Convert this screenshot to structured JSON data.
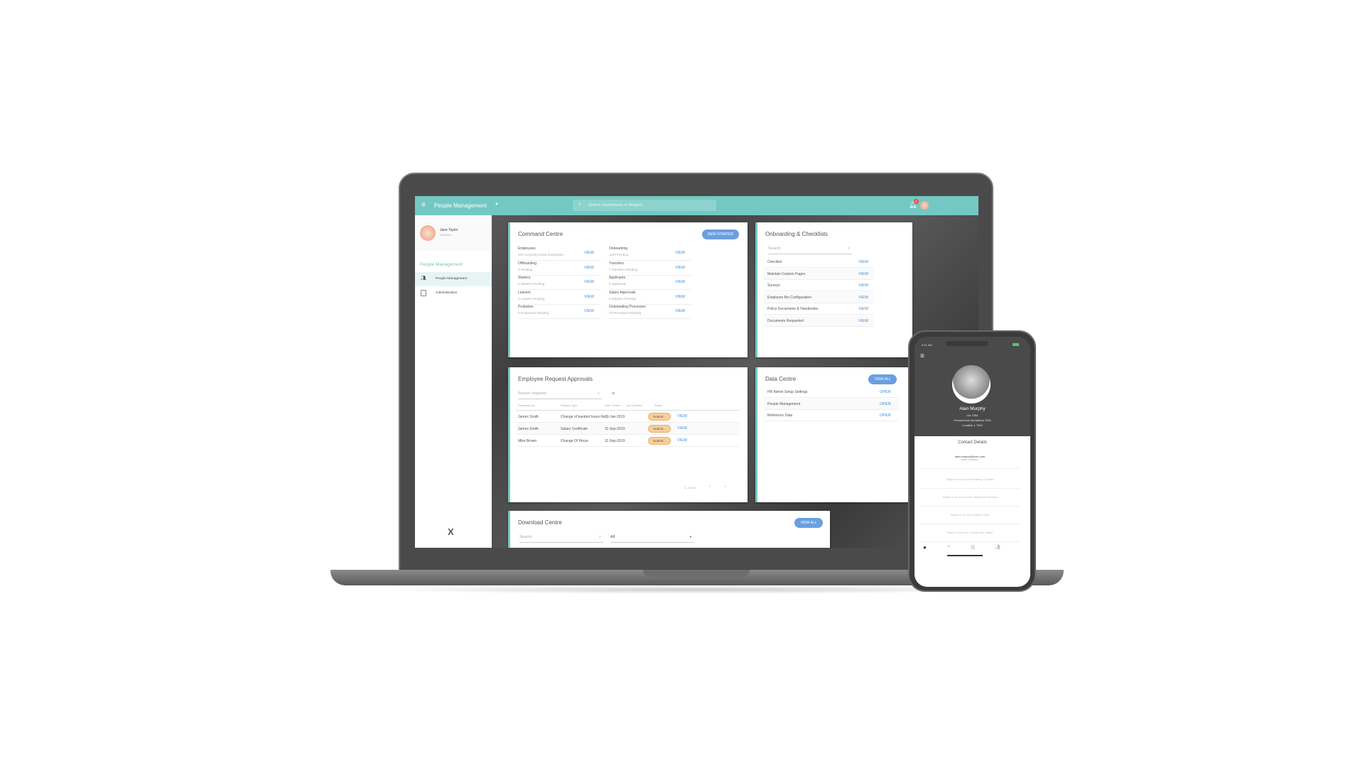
{
  "topbar": {
    "title": "People Management",
    "search_placeholder": "Search Dashboards or Widgets",
    "notification_count": "6"
  },
  "sidebar": {
    "user_name": "Jane Taylor",
    "user_id": "0000005",
    "section_title": "People Management",
    "items": [
      {
        "label": "People Management"
      },
      {
        "label": "Administration"
      }
    ],
    "logo_text": "CORE X"
  },
  "command_centre": {
    "title": "Command Centre",
    "button": "NEW STARTER",
    "view": "VIEW",
    "left": [
      {
        "label": "Employees",
        "sub": "270 Currently Active Employees"
      },
      {
        "label": "Offboarding",
        "sub": "3 Pending"
      },
      {
        "label": "Starters",
        "sub": "0 Starters Pending"
      },
      {
        "label": "Leavers",
        "sub": "0 Leavers Pending"
      },
      {
        "label": "Probation",
        "sub": "0 Probations Pending"
      }
    ],
    "right": [
      {
        "label": "Onboarding",
        "sub": "1103 Pending"
      },
      {
        "label": "Transfers",
        "sub": "7 Transfers Pending"
      },
      {
        "label": "Applicants",
        "sub": "2 Applicants"
      },
      {
        "label": "Salary Approvals",
        "sub": "6 Salaries Pending"
      },
      {
        "label": "Outstanding Processes",
        "sub": "73 Processes Pending"
      }
    ]
  },
  "onboarding": {
    "title": "Onboarding & Checklists",
    "search_placeholder": "Search",
    "view": "VIEW",
    "items": [
      "Checklist",
      "Maintain Custom Pages",
      "Surveys",
      "Employee Bio Configuration",
      "Policy Documents & Handbooks",
      "Documents Requested"
    ]
  },
  "approvals": {
    "title": "Employee Request Approvals",
    "search_placeholder": "Search requests",
    "columns": [
      "Requested By",
      "Request Type",
      "Date Created",
      "Last Updated",
      "Status"
    ],
    "view": "VIEW",
    "rows": [
      {
        "by": "James Smith",
        "type": "Change of banded hours Re...",
        "created": "30-Jan-2019",
        "updated": "",
        "status": "Submit..."
      },
      {
        "by": "James Smith",
        "type": "Salary Certificate",
        "created": "11-Sep-2019",
        "updated": "",
        "status": "Submit..."
      },
      {
        "by": "Mike Brown",
        "type": "Change Of Hours",
        "created": "11-Sep-2019",
        "updated": "",
        "status": "Submit..."
      }
    ],
    "pagination": "1 - 3 of 3"
  },
  "data_centre": {
    "title": "Data Centre",
    "button": "VIEW ALL",
    "open": "OPEN",
    "items": [
      "HR Admin Setup Settings",
      "People Management",
      "Reference Data"
    ]
  },
  "download": {
    "title": "Download Centre",
    "button": "VIEW ALL",
    "search_placeholder": "Search",
    "filter_value": "All"
  },
  "phone": {
    "time": "9:41 AM",
    "name": "Alan Murphy",
    "id": "Cio 7204",
    "department": "Product And Operations 7204",
    "location": "Location 1 7204",
    "section": "Contact Details",
    "email": "alan.murphy@core.com",
    "email_label": "EMAIL ADDRESS",
    "prompts": [
      "Swipe to set your Emergency Contact",
      "Swipe to set your Home Telephone Number",
      "Swipe to set your Eclipse User",
      "Swipe to set your Oracle User Name"
    ]
  }
}
